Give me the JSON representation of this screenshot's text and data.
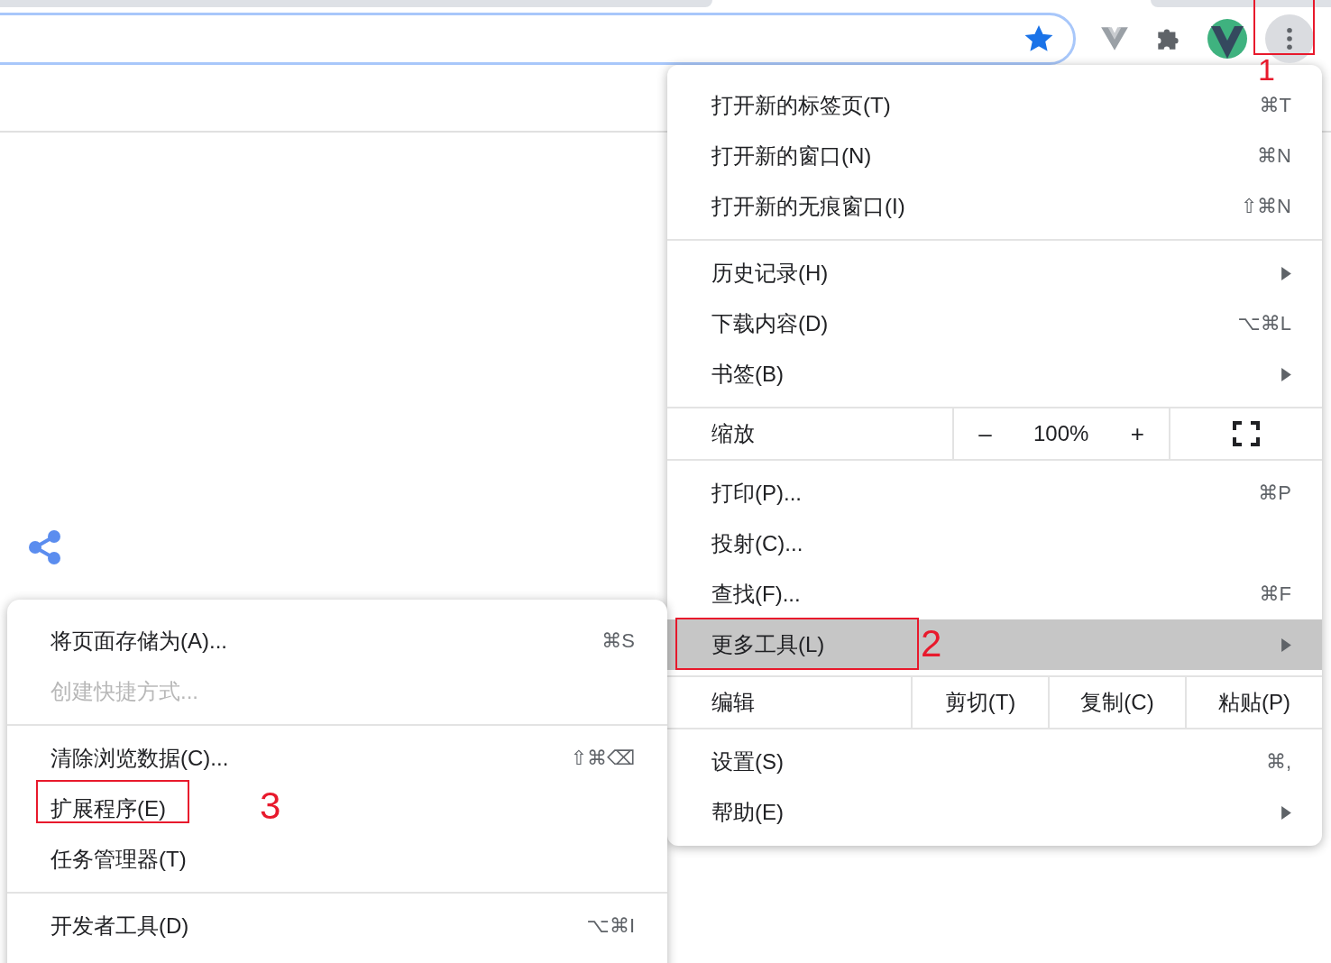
{
  "toolbar": {
    "bookmarked": true,
    "menu_button": {
      "annotation": "1"
    }
  },
  "menu": {
    "sections": [
      [
        {
          "kind": "item",
          "label": "打开新的标签页(T)",
          "shortcut": "⌘T",
          "submenu": false,
          "highlighted": false
        },
        {
          "kind": "item",
          "label": "打开新的窗口(N)",
          "shortcut": "⌘N",
          "submenu": false,
          "highlighted": false
        },
        {
          "kind": "item",
          "label": "打开新的无痕窗口(I)",
          "shortcut": "⇧⌘N",
          "submenu": false,
          "highlighted": false
        }
      ],
      [
        {
          "kind": "item",
          "label": "历史记录(H)",
          "submenu": true,
          "highlighted": false
        },
        {
          "kind": "item",
          "label": "下载内容(D)",
          "shortcut": "⌥⌘L",
          "submenu": false,
          "highlighted": false
        },
        {
          "kind": "item",
          "label": "书签(B)",
          "submenu": true,
          "highlighted": false
        }
      ],
      [
        {
          "kind": "zoom",
          "label": "缩放",
          "minus": "–",
          "value": "100%",
          "plus": "+"
        }
      ],
      [
        {
          "kind": "item",
          "label": "打印(P)...",
          "shortcut": "⌘P",
          "submenu": false,
          "highlighted": false
        },
        {
          "kind": "item",
          "label": "投射(C)...",
          "submenu": false,
          "highlighted": false
        },
        {
          "kind": "item",
          "label": "查找(F)...",
          "shortcut": "⌘F",
          "submenu": false,
          "highlighted": false
        },
        {
          "kind": "item",
          "label": "更多工具(L)",
          "submenu": true,
          "highlighted": true,
          "annotation": "2"
        }
      ],
      [
        {
          "kind": "edit",
          "label": "编辑",
          "buttons": [
            "剪切(T)",
            "复制(C)",
            "粘贴(P)"
          ]
        }
      ],
      [
        {
          "kind": "item",
          "label": "设置(S)",
          "shortcut": "⌘,",
          "submenu": false,
          "highlighted": false
        },
        {
          "kind": "item",
          "label": "帮助(E)",
          "submenu": true,
          "highlighted": false
        }
      ]
    ]
  },
  "submenu": {
    "sections": [
      [
        {
          "label": "将页面存储为(A)...",
          "shortcut": "⌘S",
          "disabled": false
        },
        {
          "label": "创建快捷方式...",
          "disabled": true
        }
      ],
      [
        {
          "label": "清除浏览数据(C)...",
          "shortcut": "⇧⌘⌫",
          "disabled": false
        },
        {
          "label": "扩展程序(E)",
          "disabled": false,
          "annotation": "3"
        },
        {
          "label": "任务管理器(T)",
          "disabled": false
        }
      ],
      [
        {
          "label": "开发者工具(D)",
          "shortcut": "⌥⌘I",
          "disabled": false
        }
      ]
    ]
  }
}
